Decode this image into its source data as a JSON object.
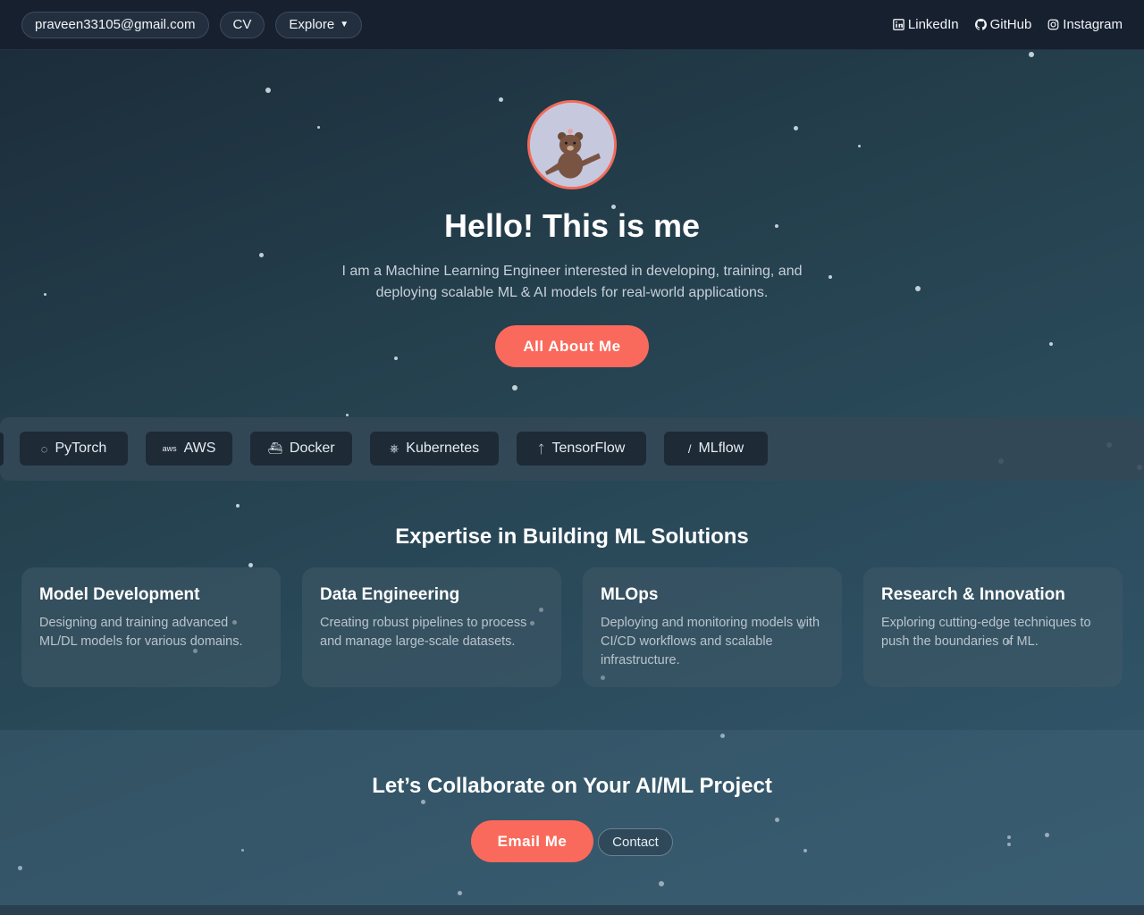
{
  "nav": {
    "email": "praveen33105@gmail.com",
    "cv": "CV",
    "explore": "Explore",
    "links": {
      "linkedin": "LinkedIn",
      "github": "GitHub",
      "instagram": "Instagram"
    }
  },
  "hero": {
    "title": "Hello! This is me",
    "description": "I am a Machine Learning Engineer interested in developing, training, and deploying scalable ML & AI models for real-world applications.",
    "cta": "All About Me"
  },
  "tech": [
    "PyTorch",
    "AWS",
    "Docker",
    "Kubernetes",
    "TensorFlow",
    "MLflow"
  ],
  "expertise": {
    "title": "Expertise in Building ML Solutions",
    "cards": [
      {
        "title": "Model Development",
        "text": "Designing and training advanced ML/DL models for various domains."
      },
      {
        "title": "Data Engineering",
        "text": "Creating robust pipelines to process and manage large-scale datasets."
      },
      {
        "title": "MLOps",
        "text": "Deploying and monitoring models with CI/CD workflows and scalable infrastructure."
      },
      {
        "title": "Research & Innovation",
        "text": "Exploring cutting-edge techniques to push the boundaries of ML."
      }
    ]
  },
  "collab": {
    "title": "Let’s Collaborate on Your AI/ML Project",
    "email_button": "Email Me",
    "contact_button": "Contact"
  },
  "colors": {
    "accent": "#fa6a5c",
    "nav_bg": "#17202f"
  }
}
